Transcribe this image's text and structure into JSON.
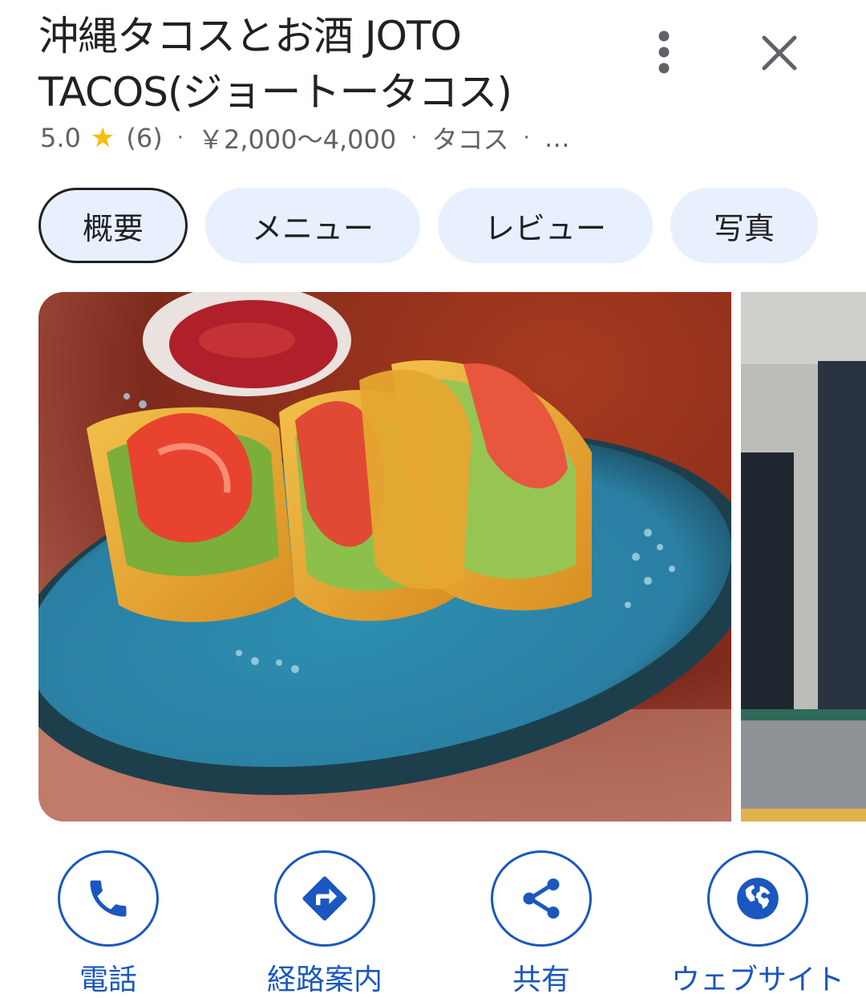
{
  "place": {
    "name": "沖縄タコスとお酒 JOTO TACOS(ジョートータコス)",
    "rating": "5.0",
    "star_icon": "star-icon",
    "review_count": "(6)",
    "separator": "·",
    "price_range": "￥2,000〜4,000",
    "category": "タコス",
    "overflow": "…"
  },
  "header": {
    "more_icon": "more-vert-icon",
    "close_icon": "close-icon"
  },
  "tabs": [
    {
      "label": "概要",
      "active": true
    },
    {
      "label": "メニュー",
      "active": false
    },
    {
      "label": "レビュー",
      "active": false
    },
    {
      "label": "写真",
      "active": false
    }
  ],
  "actions": [
    {
      "label": "電話",
      "icon": "phone-icon"
    },
    {
      "label": "経路案内",
      "icon": "directions-icon"
    },
    {
      "label": "共有",
      "icon": "share-icon"
    },
    {
      "label": "ウェブサイト",
      "icon": "globe-icon"
    }
  ],
  "colors": {
    "accent": "#1a57c0",
    "tab_background": "#e8f0fe",
    "star": "#fbbc04",
    "secondary_text": "#5f6368"
  }
}
